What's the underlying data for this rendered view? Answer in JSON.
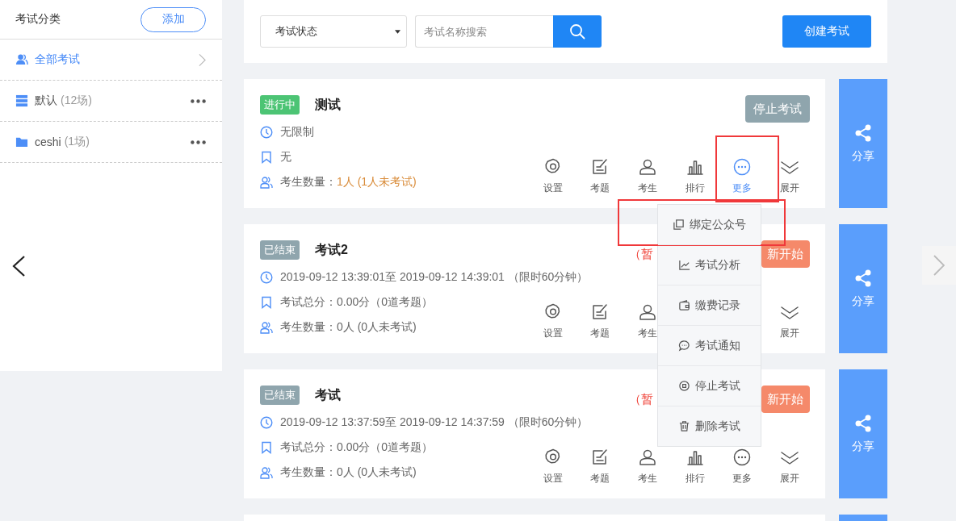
{
  "sidebar": {
    "title": "考试分类",
    "add_button": "添加",
    "items": [
      {
        "kind": "all",
        "label": "全部考试",
        "selected": true
      },
      {
        "kind": "stack",
        "label": "默认",
        "count": "(12场)",
        "selected": false
      },
      {
        "kind": "folder",
        "label": "ceshi",
        "count": "(1场)",
        "selected": false
      }
    ]
  },
  "toolbar": {
    "status_select": "考试状态",
    "search": {
      "placeholder": "考试名称搜索"
    },
    "create_button": "创建考试"
  },
  "exams": [
    {
      "badge": {
        "kind": "running",
        "label": "进行中"
      },
      "title": "测试",
      "lines": [
        {
          "kind": "time",
          "text": "无限制"
        },
        {
          "kind": "score",
          "text": "无"
        },
        {
          "kind": "students",
          "label": "考生数量：",
          "value": "1人 (1人未考试)",
          "highlight": true
        }
      ],
      "action_button": {
        "kind": "stop",
        "label": "停止考试"
      },
      "actions": [
        {
          "kind": "settings",
          "label": "设置",
          "active": false,
          "highlighted": false
        },
        {
          "kind": "questions",
          "label": "考题",
          "active": false,
          "highlighted": false
        },
        {
          "kind": "students",
          "label": "考生",
          "active": false,
          "highlighted": false
        },
        {
          "kind": "ranking",
          "label": "排行",
          "active": false,
          "highlighted": false
        },
        {
          "kind": "more",
          "label": "更多",
          "active": true,
          "highlighted": true
        },
        {
          "kind": "expand",
          "label": "展开",
          "active": false,
          "highlighted": false
        }
      ],
      "share": "分享"
    },
    {
      "badge": {
        "kind": "ended",
        "label": "已结束"
      },
      "title": "考试2",
      "lines": [
        {
          "kind": "time",
          "text": "2019-09-12 13:39:01至 2019-09-12 14:39:01 （限时60分钟）"
        },
        {
          "kind": "score",
          "text": "考试总分：0.00分（0道考题）"
        },
        {
          "kind": "students",
          "label": "考生数量：",
          "value": "0人 (0人未考试)",
          "highlight": false
        }
      ],
      "note": "（暂",
      "action_button": {
        "kind": "restart",
        "label": "新开始"
      },
      "actions": [
        {
          "kind": "settings",
          "label": "设置",
          "active": false,
          "highlighted": false
        },
        {
          "kind": "questions",
          "label": "考题",
          "active": false,
          "highlighted": false
        },
        {
          "kind": "students",
          "label": "考生",
          "active": false,
          "highlighted": false
        },
        {
          "kind": "expand",
          "label": "展开",
          "active": false,
          "highlighted": false
        }
      ],
      "share": "分享"
    },
    {
      "badge": {
        "kind": "ended",
        "label": "已结束"
      },
      "title": "考试",
      "lines": [
        {
          "kind": "time",
          "text": "2019-09-12 13:37:59至 2019-09-12 14:37:59 （限时60分钟）"
        },
        {
          "kind": "score",
          "text": "考试总分：0.00分（0道考题）"
        },
        {
          "kind": "students",
          "label": "考生数量：",
          "value": "0人 (0人未考试)",
          "highlight": false
        }
      ],
      "note": "（暂",
      "action_button": {
        "kind": "restart",
        "label": "新开始"
      },
      "actions": [
        {
          "kind": "settings",
          "label": "设置",
          "active": false,
          "highlighted": false
        },
        {
          "kind": "questions",
          "label": "考题",
          "active": false,
          "highlighted": false
        },
        {
          "kind": "students",
          "label": "考生",
          "active": false,
          "highlighted": false
        },
        {
          "kind": "ranking",
          "label": "排行",
          "active": false,
          "highlighted": false
        },
        {
          "kind": "more",
          "label": "更多",
          "active": false,
          "highlighted": false
        },
        {
          "kind": "expand",
          "label": "展开",
          "active": false,
          "highlighted": false
        }
      ],
      "share": "分享"
    }
  ],
  "more_menu": {
    "items": [
      {
        "kind": "bind",
        "label": "绑定公众号",
        "highlighted": true
      },
      {
        "kind": "analysis",
        "label": "考试分析",
        "highlighted": false
      },
      {
        "kind": "payment",
        "label": "缴费记录",
        "highlighted": false
      },
      {
        "kind": "notice",
        "label": "考试通知",
        "highlighted": false
      },
      {
        "kind": "stop",
        "label": "停止考试",
        "highlighted": false
      },
      {
        "kind": "delete",
        "label": "删除考试",
        "highlighted": false
      }
    ]
  }
}
